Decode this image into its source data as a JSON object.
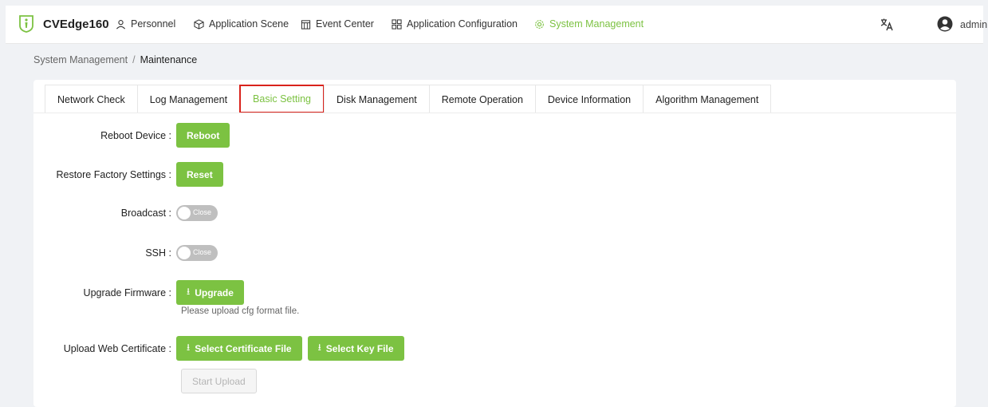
{
  "app": {
    "brand": "CVEdge160",
    "user": "admin"
  },
  "nav": [
    {
      "label": "Personnel",
      "icon": "person-icon",
      "active": false
    },
    {
      "label": "Application Scene",
      "icon": "cube-icon",
      "active": false
    },
    {
      "label": "Event Center",
      "icon": "calendar-icon",
      "active": false
    },
    {
      "label": "Application Configuration",
      "icon": "grid-icon",
      "active": false
    },
    {
      "label": "System Management",
      "icon": "gear-icon",
      "active": true
    }
  ],
  "breadcrumb": {
    "parent": "System Management",
    "separator": "/",
    "current": "Maintenance"
  },
  "tabs": [
    "Network Check",
    "Log Management",
    "Basic Setting",
    "Disk Management",
    "Remote Operation",
    "Device Information",
    "Algorithm Management"
  ],
  "active_tab": "Basic Setting",
  "settings": {
    "reboot": {
      "label": "Reboot Device :",
      "button": "Reboot"
    },
    "reset": {
      "label": "Restore Factory Settings :",
      "button": "Reset"
    },
    "broadcast": {
      "label": "Broadcast :",
      "state": "Close"
    },
    "ssh": {
      "label": "SSH :",
      "state": "Close"
    },
    "firmware": {
      "label": "Upgrade Firmware :",
      "button": "Upgrade",
      "hint": "Please upload cfg format file."
    },
    "certificate": {
      "label": "Upload Web Certificate :",
      "cert_button": "Select Certificate File",
      "key_button": "Select Key File",
      "start_button": "Start Upload"
    }
  },
  "colors": {
    "accent": "#7cc242",
    "highlight_border": "#d9231c"
  }
}
